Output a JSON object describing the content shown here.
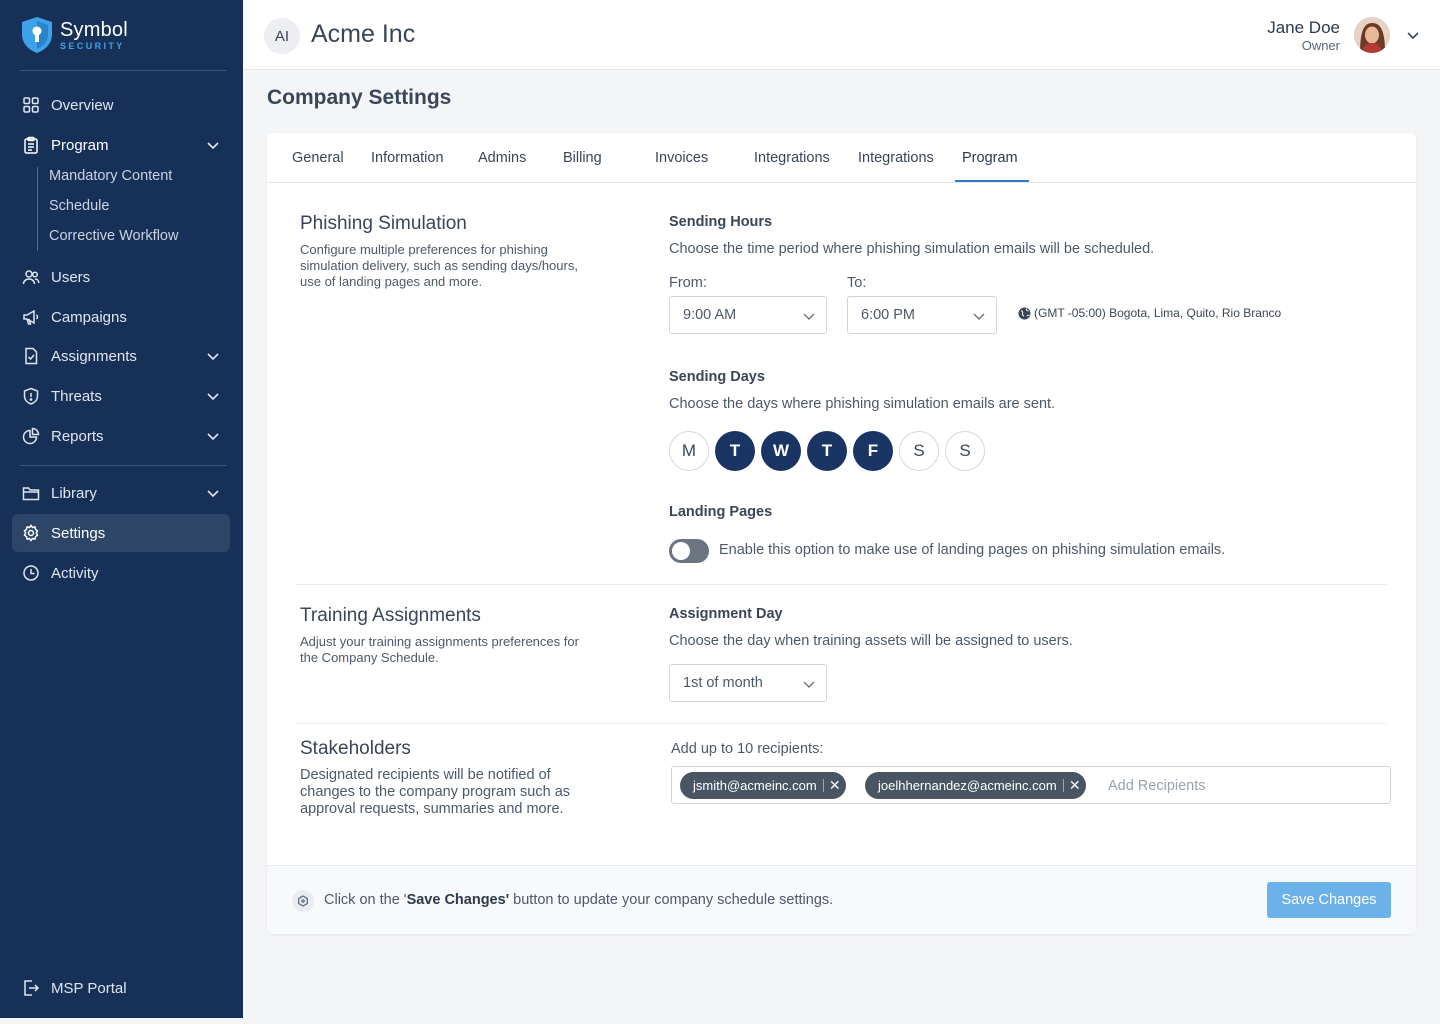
{
  "brand": {
    "name_line1": "Symbol",
    "name_line2": "SECURITY"
  },
  "sidebar": {
    "items": [
      {
        "label": "Overview"
      },
      {
        "label": "Program"
      },
      {
        "label": "Users"
      },
      {
        "label": "Campaigns"
      },
      {
        "label": "Assignments"
      },
      {
        "label": "Threats"
      },
      {
        "label": "Reports"
      },
      {
        "label": "Library"
      },
      {
        "label": "Settings"
      },
      {
        "label": "Activity"
      }
    ],
    "program_subitems": [
      "Mandatory Content",
      "Schedule",
      "Corrective Workflow"
    ],
    "bottom_link": "MSP Portal"
  },
  "header": {
    "org_initials": "AI",
    "org_name": "Acme Inc",
    "user_name": "Jane Doe",
    "user_role": "Owner"
  },
  "page": {
    "title": "Company Settings"
  },
  "tabs": [
    "General",
    "Information",
    "Admins",
    "Billing",
    "Invoices",
    "Integrations",
    "Integrations",
    "Program"
  ],
  "active_tab": "Program",
  "phishing": {
    "title": "Phishing Simulation",
    "description": "Configure multiple preferences for phishing simulation delivery, such as sending days/hours, use of landing pages and more.",
    "sending_hours_label": "Sending Hours",
    "sending_hours_help": "Choose the time period where phishing simulation emails will be scheduled.",
    "from_label": "From:",
    "from_value": "9:00 AM",
    "to_label": "To:",
    "to_value": "6:00 PM",
    "timezone": "(GMT -05:00) Bogota, Lima, Quito, Rio Branco",
    "sending_days_label": "Sending Days",
    "sending_days_help": "Choose the days where phishing simulation emails are sent.",
    "days": [
      {
        "letter": "M",
        "selected": false
      },
      {
        "letter": "T",
        "selected": true
      },
      {
        "letter": "W",
        "selected": true
      },
      {
        "letter": "T",
        "selected": true
      },
      {
        "letter": "F",
        "selected": true
      },
      {
        "letter": "S",
        "selected": false
      },
      {
        "letter": "S",
        "selected": false
      }
    ],
    "landing_pages_label": "Landing Pages",
    "landing_pages_help": "Enable this option to make use of landing pages on phishing simulation emails.",
    "landing_pages_enabled": false
  },
  "training": {
    "title": "Training Assignments",
    "description": "Adjust your training assignments preferences for the Company Schedule.",
    "assignment_day_label": "Assignment Day",
    "assignment_day_help": "Choose the day when training assets will be assigned to users.",
    "assignment_day_value": "1st of month"
  },
  "stakeholders": {
    "title": "Stakeholders",
    "description": "Designated recipients will be notified of changes to the company program such as approval requests, summaries and more.",
    "recipients_label": "Add up to 10 recipients:",
    "recipients": [
      "jsmith@acmeinc.com",
      "joelhhernandez@acmeinc.com"
    ],
    "add_placeholder": "Add Recipients"
  },
  "footer": {
    "text_before": "Click on the '",
    "text_bold": "Save Changes'",
    "text_after": " button to update your company schedule settings.",
    "save_label": "Save Changes"
  },
  "colors": {
    "sidebar_bg": "#173057",
    "sidebar_active": "#2d4668",
    "accent": "#2f7ac2",
    "day_selected": "#1a3564",
    "save_button": "#6bb2ea"
  }
}
